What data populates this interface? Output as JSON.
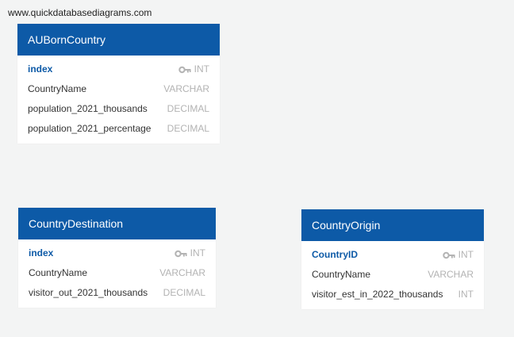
{
  "watermark": "www.quickdatabasediagrams.com",
  "colors": {
    "header": "#0d5aa7",
    "background": "#f3f4f4",
    "pk_text": "#0d5aa7",
    "type_text": "#b3b3b3"
  },
  "tables": [
    {
      "name": "AUBornCountry",
      "columns": [
        {
          "name": "index",
          "type": "INT",
          "pk": true,
          "icon": "key-icon"
        },
        {
          "name": "CountryName",
          "type": "VARCHAR",
          "pk": false
        },
        {
          "name": "population_2021_thousands",
          "type": "DECIMAL",
          "pk": false
        },
        {
          "name": "population_2021_percentage",
          "type": "DECIMAL",
          "pk": false
        }
      ]
    },
    {
      "name": "CountryDestination",
      "columns": [
        {
          "name": "index",
          "type": "INT",
          "pk": true,
          "icon": "key-icon"
        },
        {
          "name": "CountryName",
          "type": "VARCHAR",
          "pk": false
        },
        {
          "name": "visitor_out_2021_thousands",
          "type": "DECIMAL",
          "pk": false
        }
      ]
    },
    {
      "name": "CountryOrigin",
      "columns": [
        {
          "name": "CountryID",
          "type": "INT",
          "pk": true,
          "icon": "key-icon"
        },
        {
          "name": "CountryName",
          "type": "VARCHAR",
          "pk": false
        },
        {
          "name": "visitor_est_in_2022_thousands",
          "type": "INT",
          "pk": false
        }
      ]
    }
  ]
}
